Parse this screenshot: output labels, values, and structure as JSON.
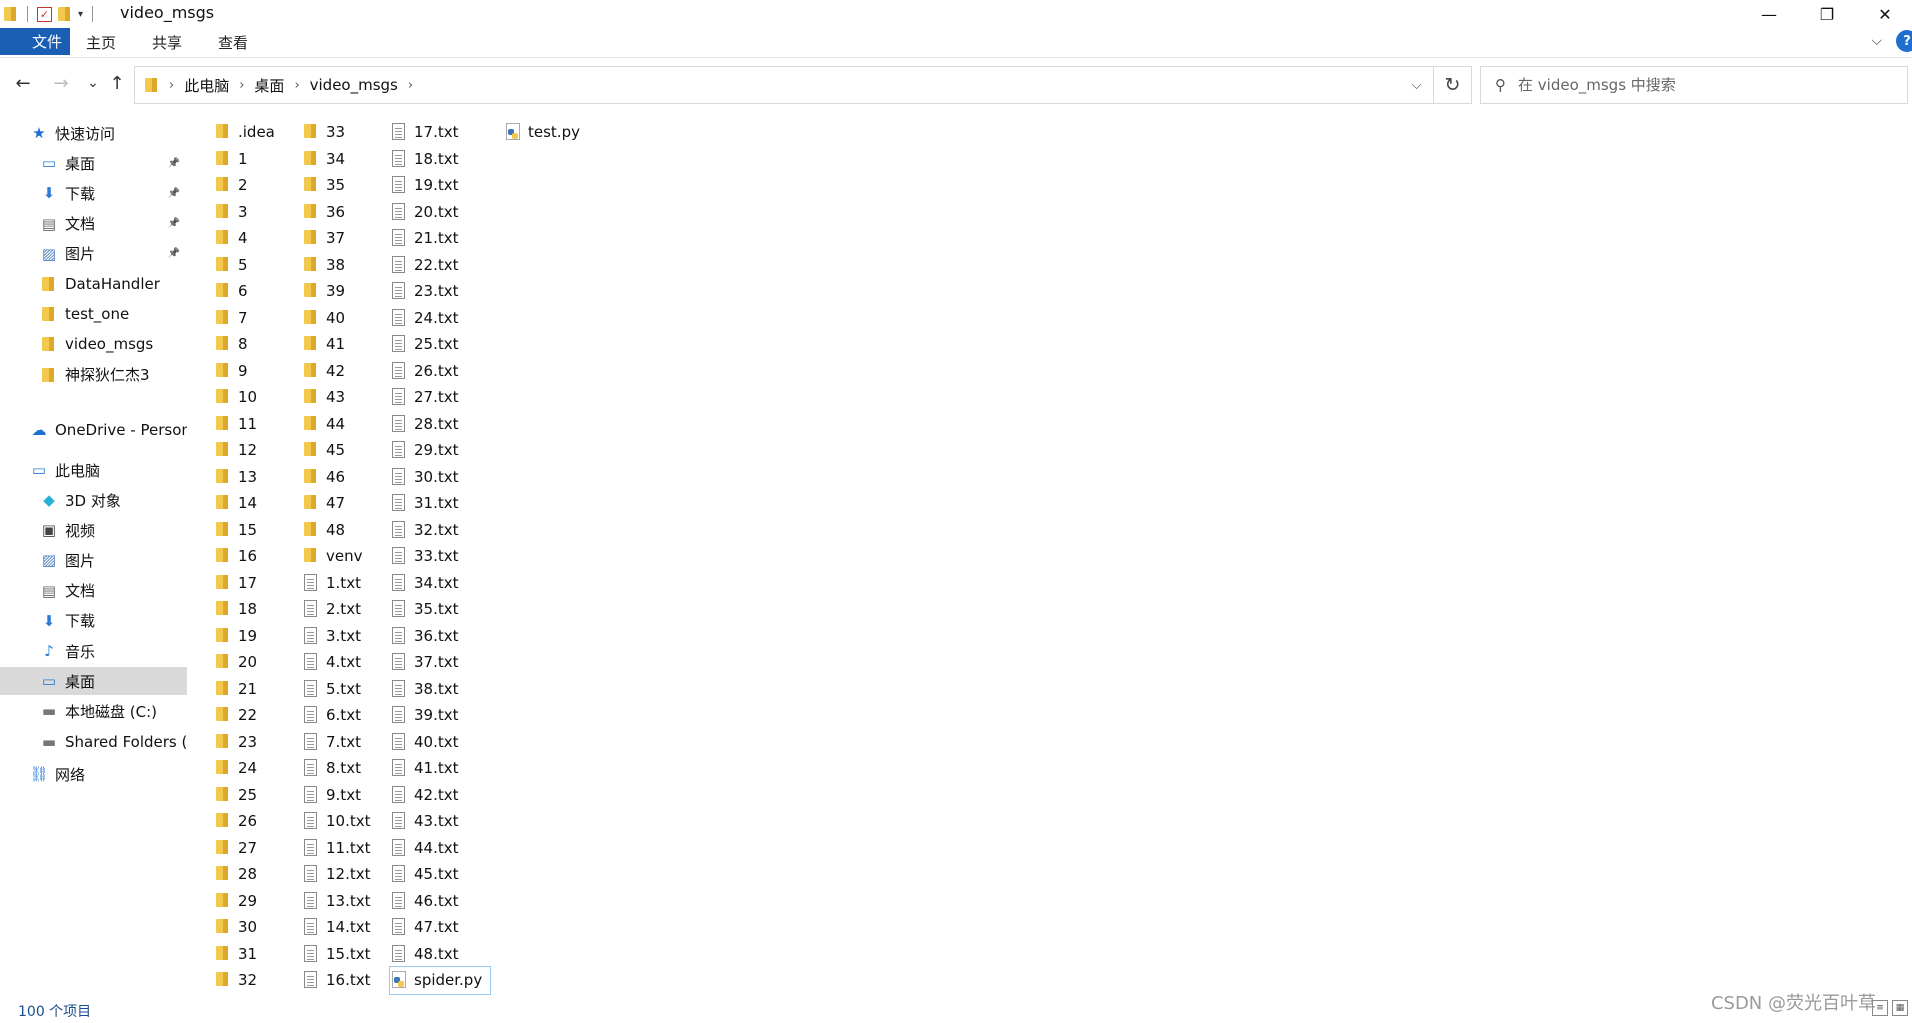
{
  "window": {
    "title": "video_msgs",
    "minimize": "—",
    "restore": "❐",
    "close": "✕"
  },
  "ribbon": {
    "tabs": [
      "文件",
      "主页",
      "共享",
      "查看"
    ],
    "expand_icon": "chevron-down-icon",
    "help_label": "?"
  },
  "navigation": {
    "back": "←",
    "forward": "→",
    "recent": "⌄",
    "up": "↑",
    "breadcrumbs": [
      "此电脑",
      "桌面",
      "video_msgs"
    ],
    "refresh": "↻"
  },
  "search": {
    "placeholder": "在 video_msgs 中搜索"
  },
  "sidebar": {
    "quick_access": "快速访问",
    "pinned": [
      "桌面",
      "下载",
      "文档",
      "图片"
    ],
    "recent": [
      "DataHandler",
      "test_one",
      "video_msgs",
      "神探狄仁杰3"
    ],
    "onedrive": "OneDrive - Person",
    "this_pc": "此电脑",
    "pc_items": [
      "3D 对象",
      "视频",
      "图片",
      "文档",
      "下载",
      "音乐",
      "桌面",
      "本地磁盘 (C:)",
      "Shared Folders (\\"
    ],
    "selected": "桌面",
    "network": "网络"
  },
  "files": {
    "col1": [
      ".idea",
      "1",
      "2",
      "3",
      "4",
      "5",
      "6",
      "7",
      "8",
      "9",
      "10",
      "11",
      "12",
      "13",
      "14",
      "15",
      "16",
      "17",
      "18",
      "19",
      "20",
      "21",
      "22",
      "23",
      "24",
      "25",
      "26",
      "27",
      "28",
      "29",
      "30",
      "31",
      "32"
    ],
    "col2": [
      "33",
      "34",
      "35",
      "36",
      "37",
      "38",
      "39",
      "40",
      "41",
      "42",
      "43",
      "44",
      "45",
      "46",
      "47",
      "48",
      "venv",
      "1.txt",
      "2.txt",
      "3.txt",
      "4.txt",
      "5.txt",
      "6.txt",
      "7.txt",
      "8.txt",
      "9.txt",
      "10.txt",
      "11.txt",
      "12.txt",
      "13.txt",
      "14.txt",
      "15.txt",
      "16.txt"
    ],
    "col3": [
      "17.txt",
      "18.txt",
      "19.txt",
      "20.txt",
      "21.txt",
      "22.txt",
      "23.txt",
      "24.txt",
      "25.txt",
      "26.txt",
      "27.txt",
      "28.txt",
      "29.txt",
      "30.txt",
      "31.txt",
      "32.txt",
      "33.txt",
      "34.txt",
      "35.txt",
      "36.txt",
      "37.txt",
      "38.txt",
      "39.txt",
      "40.txt",
      "41.txt",
      "42.txt",
      "43.txt",
      "44.txt",
      "45.txt",
      "46.txt",
      "47.txt",
      "48.txt",
      "spider.py"
    ],
    "col4": [
      "test.py"
    ],
    "selected": "spider.py"
  },
  "status": {
    "count": "100 个项目",
    "watermark": "CSDN @荧光百叶草"
  }
}
